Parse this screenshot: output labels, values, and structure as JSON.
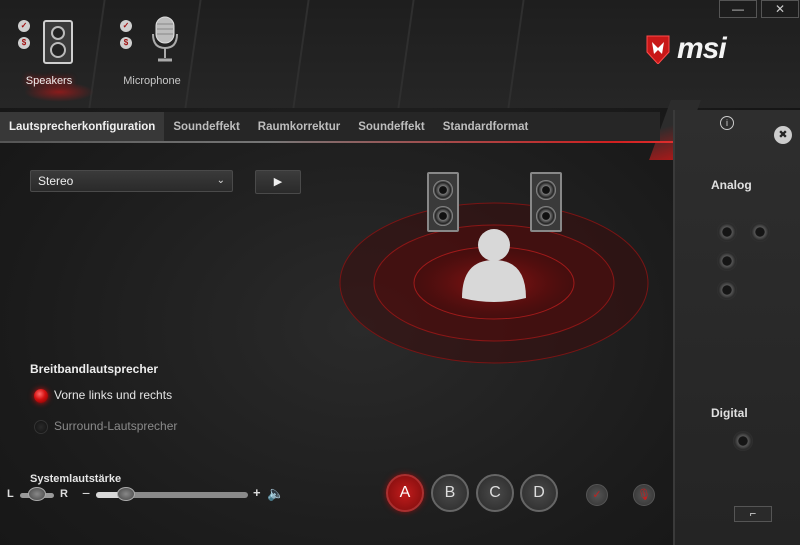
{
  "devices": {
    "speakers": {
      "label": "Speakers",
      "icon": "speaker-cabinet-icon"
    },
    "microphone": {
      "label": "Microphone",
      "icon": "studio-microphone-icon"
    }
  },
  "window": {
    "minimize": "—",
    "close": "✕"
  },
  "brand": {
    "name": "msi",
    "icon": "dragon-shield-icon",
    "accent": "#d01818"
  },
  "tabs": [
    {
      "label": "Lautsprecherkonfiguration",
      "active": true
    },
    {
      "label": "Soundeffekt",
      "active": false
    },
    {
      "label": "Raumkorrektur",
      "active": false
    },
    {
      "label": "Soundeffekt",
      "active": false
    },
    {
      "label": "Standardformat",
      "active": false
    }
  ],
  "config": {
    "selected": "Stereo",
    "play_icon": "▶"
  },
  "breitband": {
    "title": "Breitbandlautsprecher",
    "options": [
      {
        "label": "Vorne links und rechts",
        "checked": true
      },
      {
        "label": "Surround-Lautsprecher",
        "checked": false
      }
    ]
  },
  "volume": {
    "title": "Systemlautstärke",
    "left": "L",
    "right": "R",
    "minus": "−",
    "plus": "+",
    "balance": 0.5,
    "level": 0.2,
    "speaker_icon": "🔈"
  },
  "presets": [
    "A",
    "B",
    "C",
    "D"
  ],
  "side": {
    "analog": "Analog",
    "digital": "Digital",
    "info_icon": "i",
    "tool_icon": "✖",
    "key_icon": "⌐"
  }
}
